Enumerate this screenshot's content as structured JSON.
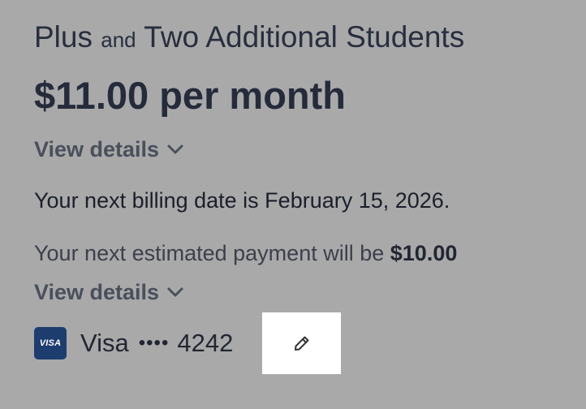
{
  "plan": {
    "name_part1": "Plus",
    "connector": "and",
    "name_part2": "Two Additional Students",
    "price": "$11.00 per month"
  },
  "details": {
    "toggle_label": "View details"
  },
  "billing": {
    "next_date_text": "Your next billing date is February 15, 2026."
  },
  "estimate": {
    "text": "Your next estimated payment will be",
    "amount": "$10.00"
  },
  "payment_method": {
    "brand_badge": "VISA",
    "brand": "Visa",
    "dots": "••••",
    "last4": "4242"
  },
  "icons": {
    "toggle": "chevron-down-icon",
    "edit": "pencil-icon"
  },
  "colors": {
    "background": "#a9a9a9",
    "visa_badge": "#1d3d6e",
    "edit_button": "#ffffff"
  }
}
